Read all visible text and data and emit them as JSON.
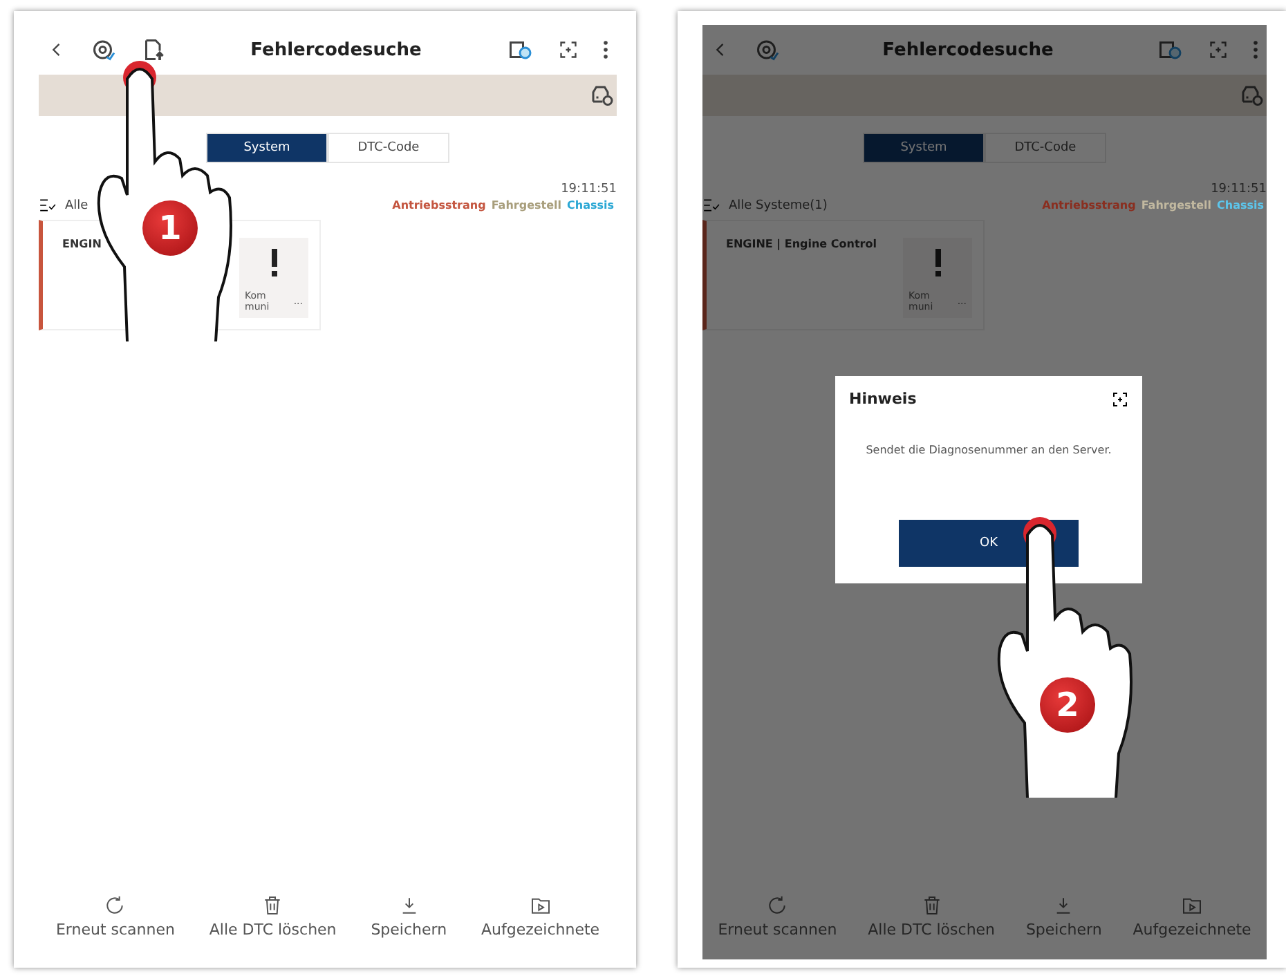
{
  "screens": [
    {
      "title": "Fehlercodesuche",
      "left_icons": [
        {
          "kind": "back"
        },
        {
          "kind": "diagnose"
        },
        {
          "kind": "upload"
        }
      ],
      "tabs": [
        {
          "label": "System",
          "selected": true
        },
        {
          "label": "DTC-Code",
          "selected": false
        }
      ],
      "time": "19:11:51",
      "filter_label": "Alle",
      "categories": [
        {
          "label": "Antriebsstrang",
          "color": "#c4553f"
        },
        {
          "label": "Fahrgestell",
          "color": "#a89e7c"
        },
        {
          "label": "Chassis",
          "color": "#2aa7d4"
        }
      ],
      "module": {
        "title": "ENGIN",
        "status": "Kom muni",
        "value": "..."
      },
      "actions": [
        {
          "kind": "rescan",
          "label": "Erneut scannen"
        },
        {
          "kind": "delete",
          "label": "Alle DTC löschen"
        },
        {
          "kind": "save",
          "label": "Speichern"
        },
        {
          "kind": "records",
          "label": "Aufgezeichnete"
        }
      ],
      "dimmed": false,
      "pointer": {
        "number": "1"
      }
    },
    {
      "title": "Fehlercodesuche",
      "left_icons": [
        {
          "kind": "back"
        },
        {
          "kind": "diagnose"
        }
      ],
      "tabs": [
        {
          "label": "System",
          "selected": true
        },
        {
          "label": "DTC-Code",
          "selected": false
        }
      ],
      "time": "19:11:51",
      "filter_label": "Alle Systeme(1)",
      "categories": [
        {
          "label": "Antriebsstrang",
          "color": "#8a2e1f"
        },
        {
          "label": "Fahrgestell",
          "color": "#c2b9a0"
        },
        {
          "label": "Chassis",
          "color": "#5cc6ec"
        }
      ],
      "module": {
        "title": "ENGINE | Engine Control",
        "status": "Kom muni",
        "value": "..."
      },
      "actions": [
        {
          "kind": "rescan",
          "label": "Erneut scannen"
        },
        {
          "kind": "delete",
          "label": "Alle DTC löschen"
        },
        {
          "kind": "save",
          "label": "Speichern"
        },
        {
          "kind": "records",
          "label": "Aufgezeichnete"
        }
      ],
      "dimmed": true,
      "dialog": {
        "title": "Hinweis",
        "message": "Sendet die Diagnosenummer an den Server.",
        "button": "OK"
      },
      "pointer": {
        "number": "2"
      }
    }
  ]
}
